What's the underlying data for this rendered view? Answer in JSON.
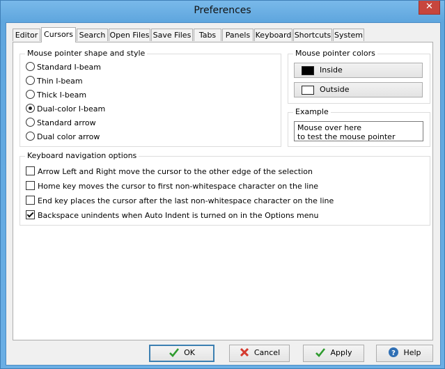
{
  "window": {
    "title": "Preferences"
  },
  "tabs": [
    {
      "label": "Editor"
    },
    {
      "label": "Cursors"
    },
    {
      "label": "Search"
    },
    {
      "label": "Open Files"
    },
    {
      "label": "Save Files"
    },
    {
      "label": "Tabs"
    },
    {
      "label": "Panels"
    },
    {
      "label": "Keyboard"
    },
    {
      "label": "Shortcuts"
    },
    {
      "label": "System"
    }
  ],
  "active_tab": "Cursors",
  "pointer_shape": {
    "title": "Mouse pointer shape and style",
    "options": [
      {
        "label": "Standard I-beam",
        "selected": false
      },
      {
        "label": "Thin I-beam",
        "selected": false
      },
      {
        "label": "Thick I-beam",
        "selected": false
      },
      {
        "label": "Dual-color I-beam",
        "selected": true
      },
      {
        "label": "Standard arrow",
        "selected": false
      },
      {
        "label": "Dual color arrow",
        "selected": false
      }
    ]
  },
  "pointer_colors": {
    "title": "Mouse pointer colors",
    "inside_label": "Inside",
    "outside_label": "Outside",
    "inside_color": "#000000",
    "outside_color": "#ffffff"
  },
  "example": {
    "title": "Example",
    "line1": "Mouse over here",
    "line2": "to test the mouse pointer"
  },
  "keyboard_nav": {
    "title": "Keyboard navigation options",
    "options": [
      {
        "label": "Arrow Left and Right move the cursor to the other edge of the selection",
        "checked": false
      },
      {
        "label": "Home key moves the cursor to first non-whitespace character on the line",
        "checked": false
      },
      {
        "label": "End key places the cursor after the last non-whitespace character on the line",
        "checked": false
      },
      {
        "label": "Backspace unindents when Auto Indent is turned on in the Options menu",
        "checked": true
      }
    ]
  },
  "footer": {
    "ok_label": "OK",
    "cancel_label": "Cancel",
    "apply_label": "Apply",
    "help_label": "Help"
  }
}
